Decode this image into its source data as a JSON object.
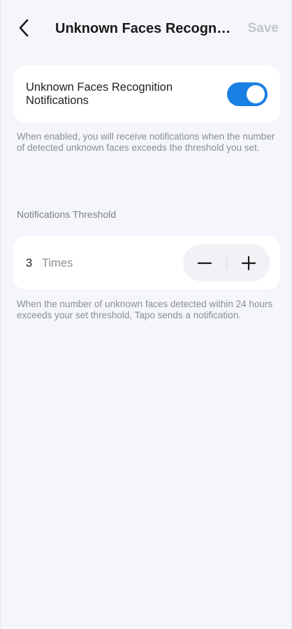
{
  "header": {
    "title": "Unknown Faces Recognition Notifications",
    "save_label": "Save"
  },
  "toggle": {
    "label": "Unknown Faces Recognition Notifications",
    "enabled": true,
    "accent_color": "#1a7fe3",
    "description": "When enabled, you will receive notifications when the number of detected unknown faces exceeds the threshold you set."
  },
  "threshold": {
    "section_label": "Notifications Threshold",
    "value": "3",
    "unit": "Times",
    "description": "When the number of unknown faces detected within 24 hours exceeds your set threshold, Tapo sends a notification."
  },
  "icons": {
    "back": "chevron-left-icon",
    "minus": "minus-icon",
    "plus": "plus-icon"
  }
}
